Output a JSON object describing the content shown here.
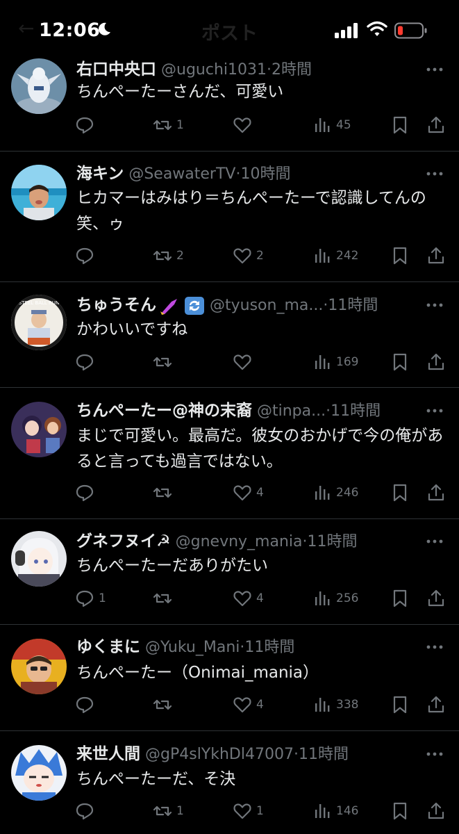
{
  "status_bar": {
    "time": "12:06",
    "page_title": "ポスト"
  },
  "colors": {
    "background": "#000000",
    "text_primary": "#e7e9ea",
    "text_secondary": "#71767b",
    "divider": "#2f3336",
    "battery_low": "#ff3b30"
  },
  "tweets": [
    {
      "name": "右口中央口",
      "handle": "@uguchi1031",
      "time": "2時間",
      "text": "ちんぺーたーさんだ、可愛い",
      "replies": "",
      "reposts": "1",
      "likes": "",
      "views": "45",
      "avatar_icon": "lugia-figure-avatar"
    },
    {
      "name": "海キン",
      "handle": "@SeawaterTV",
      "time": "10時間",
      "text": "ヒカマーはみはり＝ちんぺーたーで認識してんの笑、ゥ",
      "replies": "",
      "reposts": "2",
      "likes": "2",
      "views": "242",
      "avatar_icon": "beach-man-avatar"
    },
    {
      "name": "ちゅうそん",
      "handle": "@tyuson_ma...",
      "time": "11時間",
      "text": "かわいいですね",
      "replies": "",
      "reposts": "",
      "likes": "",
      "views": "169",
      "avatar_icon": "steel-ball-run-avatar",
      "name_emojis": [
        "nail-polish-emoji",
        "repeat-arrows-emoji"
      ]
    },
    {
      "name": "ちんぺーたー@神の末裔",
      "handle": "@tinpa...",
      "time": "11時間",
      "text": "まじで可愛い。最高だ。彼女のおかげで今の俺があると言っても過言ではない。",
      "replies": "",
      "reposts": "",
      "likes": "4",
      "views": "246",
      "avatar_icon": "anime-group-avatar"
    },
    {
      "name": "グネフヌイ☭",
      "handle": "@gnevny_mania",
      "time": "11時間",
      "text": "ちんぺーたーだありがたい",
      "replies": "1",
      "reposts": "",
      "likes": "4",
      "views": "256",
      "avatar_icon": "anime-headphones-avatar"
    },
    {
      "name": "ゆくまに",
      "handle": "@Yuku_Mani",
      "time": "11時間",
      "text": "ちんぺーたー（Onimai_mania）",
      "replies": "",
      "reposts": "",
      "likes": "4",
      "views": "338",
      "avatar_icon": "orange-man-avatar"
    },
    {
      "name": "来世人間",
      "handle": "@gP4slYkhDl47007",
      "time": "11時間",
      "text": "ちんぺーたーだ、そ決",
      "replies": "",
      "reposts": "1",
      "likes": "1",
      "views": "146",
      "avatar_icon": "blue-hair-anime-avatar"
    }
  ]
}
